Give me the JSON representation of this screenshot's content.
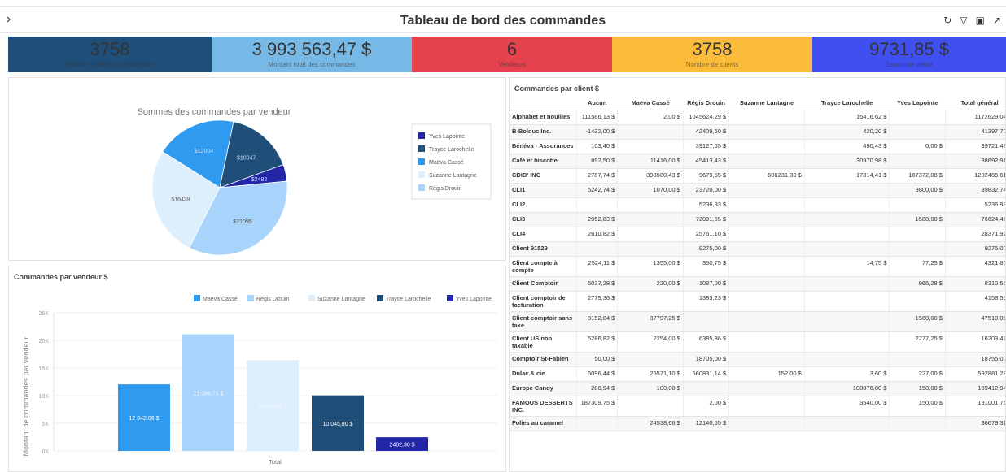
{
  "header": {
    "title": "Tableau de bord des commandes",
    "toggle_icon": "chevron-right-icon",
    "tools": [
      "refresh-icon",
      "filter-clear-icon",
      "save-icon",
      "export-icon"
    ]
  },
  "kpis": [
    {
      "value": "3758",
      "label": "Nombre total des commandes",
      "bg": "#1f4e79",
      "fg": "#333333"
    },
    {
      "value": "3 993 563,47 $",
      "label": "Montant total des commandes",
      "bg": "#77b9e6",
      "fg": "#333333"
    },
    {
      "value": "6",
      "label": "Vendeurs",
      "bg": "#e5424d",
      "fg": "#333333"
    },
    {
      "value": "3758",
      "label": "Nombre de clients",
      "bg": "#fbbb3b",
      "fg": "#333333"
    },
    {
      "value": "9731,85 $",
      "label": "Escompte dédui",
      "bg": "#3f4ff0",
      "fg": "#333333"
    }
  ],
  "pie": {
    "title": "Sommes des commandes par vendeur",
    "legend": [
      "Yves Lapointe",
      "Trayce Larochelle",
      "Maëva Cassé",
      "Suzanne Lantagne",
      "Régis Drouin"
    ],
    "slice_labels": [
      "$12004",
      "$10047",
      "$2482",
      "$16439",
      "$21095"
    ]
  },
  "bar": {
    "title": "Commandes par vendeur $",
    "ylabel": "Montant de commandes par vendeur",
    "xlabel": "Total",
    "ticks": [
      "0K",
      "5K",
      "10K",
      "15K",
      "20K",
      "25K"
    ],
    "legend": [
      "Maëva Cassé",
      "Régis Drouin",
      "Suzanne Lantagne",
      "Trayce Larochelle",
      "Yves Lapointe"
    ],
    "bar_labels": [
      "12 042,06 $",
      "21 094,75 $",
      "16 439,01 $",
      "10 045,80 $",
      "2482,30 $"
    ]
  },
  "colors": {
    "maeva": "#2e9bf0",
    "regis": "#a8d4fb",
    "suzanne": "#ddeefd",
    "trayce": "#1f4e79",
    "yves": "#2426a8"
  },
  "chart_data": [
    {
      "type": "pie",
      "title": "Sommes des commandes par vendeur",
      "categories": [
        "Maëva Cassé",
        "Trayce Larochelle",
        "Yves Lapointe",
        "Régis Drouin",
        "Suzanne Lantagne"
      ],
      "values": [
        12004,
        10047,
        2482,
        21095,
        16439
      ]
    },
    {
      "type": "bar",
      "title": "Commandes par vendeur $",
      "ylabel": "Montant de commandes par vendeur",
      "xlabel": "Total",
      "categories": [
        "Total"
      ],
      "series": [
        {
          "name": "Maëva Cassé",
          "values": [
            12042.06
          ]
        },
        {
          "name": "Régis Drouin",
          "values": [
            21094.75
          ]
        },
        {
          "name": "Suzanne Lantagne",
          "values": [
            16439.01
          ]
        },
        {
          "name": "Trayce Larochelle",
          "values": [
            10045.8
          ]
        },
        {
          "name": "Yves Lapointe",
          "values": [
            2482.3
          ]
        }
      ],
      "ylim": [
        0,
        25000
      ]
    }
  ],
  "table": {
    "title": "Commandes par client $",
    "columns": [
      "",
      "Aucun",
      "Maëva Cassé",
      "Régis Drouin",
      "Suzanne Lantagne",
      "Trayce Larochelle",
      "Yves Lapointe",
      "Total général"
    ],
    "rows": [
      [
        "Alphabet et nouilles",
        "111586,13 $",
        "2,00 $",
        "1045624,29 $",
        "",
        "15416,62 $",
        "",
        "1172629,04 $"
      ],
      [
        "B-Bolduc Inc.",
        "-1432,00 $",
        "",
        "42409,50 $",
        "",
        "420,20 $",
        "",
        "41397,70 $"
      ],
      [
        "Bénéva - Assurances",
        "103,40 $",
        "",
        "39127,65 $",
        "",
        "490,43 $",
        "0,00 $",
        "39721,48 $"
      ],
      [
        "Café et biscotte",
        "892,50 $",
        "11416,00 $",
        "45413,43 $",
        "",
        "30970,98 $",
        "",
        "88692,91 $"
      ],
      [
        "CDID' INC",
        "2787,74 $",
        "398580,43 $",
        "9679,65 $",
        "606231,30 $",
        "17814,41 $",
        "167372,08 $",
        "1202465,61 $"
      ],
      [
        "CLI1",
        "5242,74 $",
        "1070,00 $",
        "23720,00 $",
        "",
        "",
        "9800,00 $",
        "39832,74 $"
      ],
      [
        "CLI2",
        "",
        "",
        "5236,93 $",
        "",
        "",
        "",
        "5236,93 $"
      ],
      [
        "CLI3",
        "2952,83 $",
        "",
        "72091,65 $",
        "",
        "",
        "1580,00 $",
        "76624,48 $"
      ],
      [
        "CLI4",
        "2610,82 $",
        "",
        "25761,10 $",
        "",
        "",
        "",
        "28371,92 $"
      ],
      [
        "Client 91529",
        "",
        "",
        "9275,00 $",
        "",
        "",
        "",
        "9275,00 $"
      ],
      [
        "Client compte à compte",
        "2524,11 $",
        "1355,00 $",
        "350,75 $",
        "",
        "14,75 $",
        "77,25 $",
        "4321,86 $"
      ],
      [
        "Client Comptoir",
        "6037,28 $",
        "220,00 $",
        "1087,00 $",
        "",
        "",
        "966,28 $",
        "8310,56 $"
      ],
      [
        "Client comptoir de facturation",
        "2775,36 $",
        "",
        "1383,23 $",
        "",
        "",
        "",
        "4158,59 $"
      ],
      [
        "Client comptoir sans taxe",
        "8152,84 $",
        "37797,25 $",
        "",
        "",
        "",
        "1560,00 $",
        "47510,09 $"
      ],
      [
        "Client US non taxable",
        "5286,82 $",
        "2254,00 $",
        "6385,36 $",
        "",
        "",
        "2277,25 $",
        "16203,43 $"
      ],
      [
        "Comptoir St-Fabien",
        "50,00 $",
        "",
        "18705,00 $",
        "",
        "",
        "",
        "18755,00 $"
      ],
      [
        "Dulac & cie",
        "6096,44 $",
        "25571,10 $",
        "560831,14 $",
        "152,00 $",
        "3,60 $",
        "227,00 $",
        "592881,28 $"
      ],
      [
        "Europe Candy",
        "286,94 $",
        "100,00 $",
        "",
        "",
        "108876,00 $",
        "150,00 $",
        "109412,94 $"
      ],
      [
        "FAMOUS DESSERTS INC.",
        "187309,75 $",
        "",
        "2,00 $",
        "",
        "3540,00 $",
        "150,00 $",
        "191001,75 $"
      ],
      [
        "Folies au caramel",
        "",
        "24538,66 $",
        "12140,65 $",
        "",
        "",
        "",
        "36679,31 $"
      ]
    ]
  }
}
